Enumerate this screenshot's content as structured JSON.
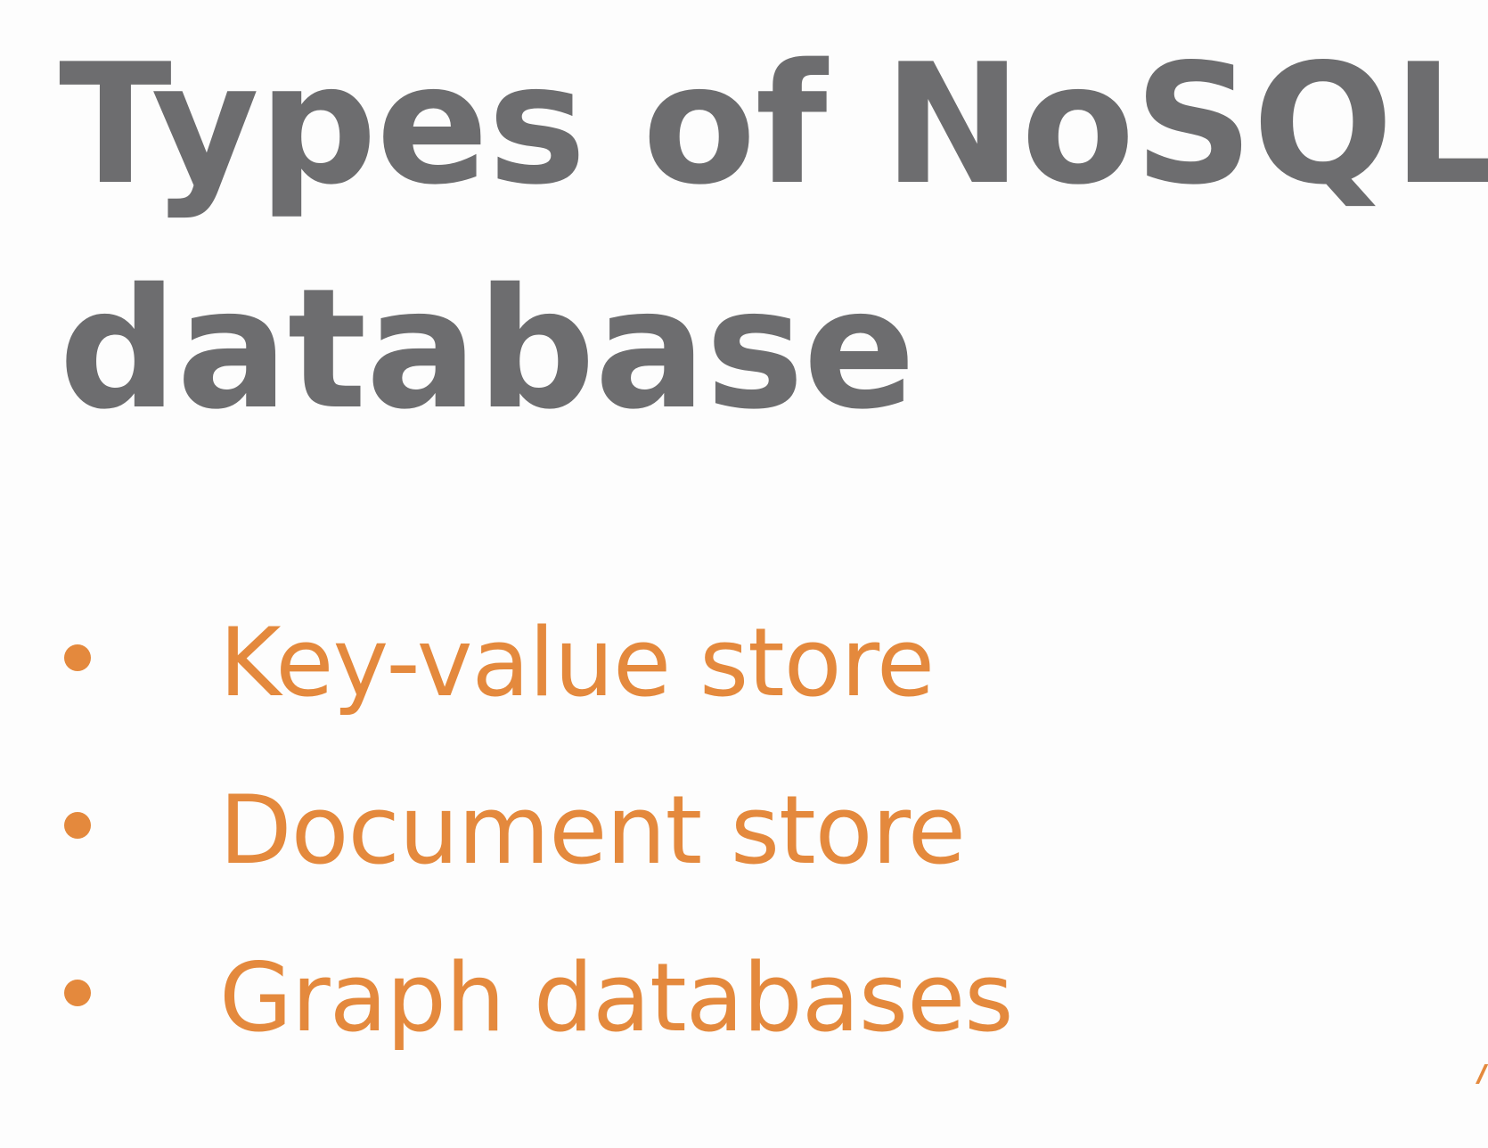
{
  "slide": {
    "title_line_1": "Types of NoSQL",
    "title_line_2": "database",
    "bullets": [
      {
        "label": "Key-value store"
      },
      {
        "label": "Document store"
      },
      {
        "label": "Graph databases"
      }
    ]
  },
  "colors": {
    "title": "#6d6d6f",
    "accent": "#e4893d",
    "background": "#fdfdfd"
  }
}
